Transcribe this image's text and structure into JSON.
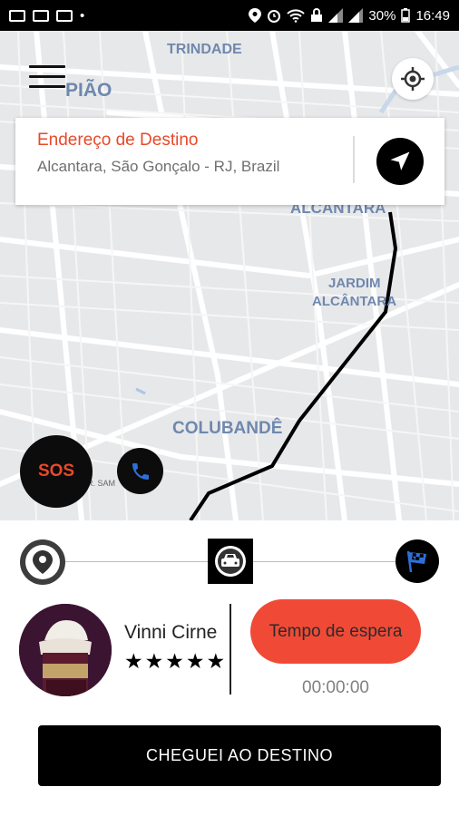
{
  "status_bar": {
    "battery": "30%",
    "time": "16:49"
  },
  "map": {
    "labels": {
      "trindade": "TRINDADE",
      "piao": "PIÃO",
      "alcantara": "ALCANTARA",
      "jardim": "JARDIM",
      "jardim_alcantara": "ALCÂNTARA",
      "colubande": "COLUBANDÊ",
      "street": "R. SAM"
    }
  },
  "destination": {
    "label": "Endereço de Destino",
    "address": "Alcantara, São Gonçalo - RJ, Brazil"
  },
  "sos_label": "SOS",
  "driver": {
    "name": "Vinni Cirne",
    "rating": "★★★★★"
  },
  "wait": {
    "label": "Tempo de espera",
    "time": "00:00:00"
  },
  "arrive_label": "CHEGUEI AO DESTINO",
  "colors": {
    "accent": "#e8492a",
    "wait_button": "#f04a37",
    "map_bg": "#e7e8ea",
    "label": "#6f88ad"
  },
  "icons": [
    "menu-icon",
    "crosshair-icon",
    "navigation-arrow-icon",
    "phone-icon",
    "location-pin-icon",
    "car-icon",
    "checkered-flag-icon"
  ]
}
